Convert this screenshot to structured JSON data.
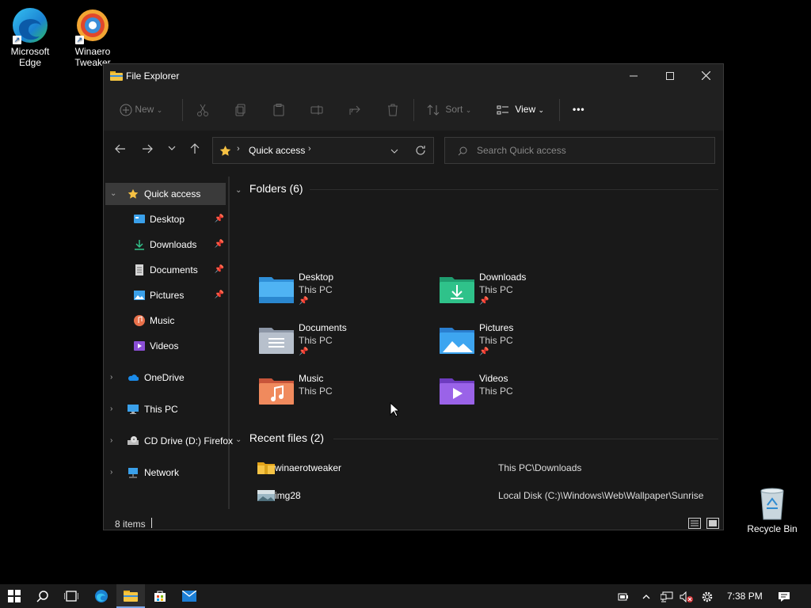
{
  "desktop": {
    "icons": [
      {
        "label": "Microsoft Edge",
        "icon": "edge-icon"
      },
      {
        "label": "Winaero Tweaker",
        "icon": "winaero-tweaker-icon"
      }
    ],
    "recycle_bin": {
      "label": "Recycle Bin",
      "icon": "recycle-bin-icon"
    }
  },
  "window": {
    "title": "File Explorer",
    "controls": {
      "minimize": "minimize-icon",
      "maximize": "maximize-icon",
      "close": "close-icon"
    }
  },
  "commandbar": {
    "new_label": "New",
    "sort_label": "Sort",
    "view_label": "View",
    "more_label": "•••"
  },
  "address": {
    "path_label": "Quick access",
    "search_placeholder": "Search Quick access"
  },
  "navpane": {
    "items": [
      {
        "label": "Quick access",
        "icon": "star-icon",
        "expanded": true
      },
      {
        "label": "Desktop",
        "icon": "desktop-folder-icon",
        "pinned": true
      },
      {
        "label": "Downloads",
        "icon": "download-icon",
        "pinned": true
      },
      {
        "label": "Documents",
        "icon": "documents-icon",
        "pinned": true
      },
      {
        "label": "Pictures",
        "icon": "pictures-icon",
        "pinned": true
      },
      {
        "label": "Music",
        "icon": "music-icon"
      },
      {
        "label": "Videos",
        "icon": "videos-icon"
      },
      {
        "label": "OneDrive",
        "icon": "onedrive-icon"
      },
      {
        "label": "This PC",
        "icon": "this-pc-icon"
      },
      {
        "label": "CD Drive (D:) Firefox",
        "icon": "cd-drive-icon"
      },
      {
        "label": "Network",
        "icon": "network-icon"
      }
    ]
  },
  "content": {
    "folders_header": "Folders (6)",
    "folders": [
      {
        "name": "Desktop",
        "location": "This PC",
        "pinned": true,
        "icon": "desktop-folder-icon"
      },
      {
        "name": "Downloads",
        "location": "This PC",
        "pinned": true,
        "icon": "downloads-folder-icon"
      },
      {
        "name": "Documents",
        "location": "This PC",
        "pinned": true,
        "icon": "documents-folder-icon"
      },
      {
        "name": "Pictures",
        "location": "This PC",
        "pinned": true,
        "icon": "pictures-folder-icon"
      },
      {
        "name": "Music",
        "location": "This PC",
        "pinned": false,
        "icon": "music-folder-icon"
      },
      {
        "name": "Videos",
        "location": "This PC",
        "pinned": false,
        "icon": "videos-folder-icon"
      }
    ],
    "recent_header": "Recent files (2)",
    "recent": [
      {
        "name": "winaerotweaker",
        "path": "This PC\\Downloads",
        "icon": "folder-zip-icon"
      },
      {
        "name": "img28",
        "path": "Local Disk (C:)\\Windows\\Web\\Wallpaper\\Sunrise",
        "icon": "image-file-icon"
      }
    ]
  },
  "statusbar": {
    "items_count": "8 items"
  },
  "taskbar": {
    "clock": "7:38 PM",
    "apps": [
      "start-icon",
      "search-icon",
      "task-view-icon",
      "edge-icon",
      "file-explorer-icon",
      "store-icon",
      "mail-icon"
    ]
  },
  "colors": {
    "accent": "#0078d4",
    "window_bg": "#191919",
    "title_bg": "#202020"
  }
}
